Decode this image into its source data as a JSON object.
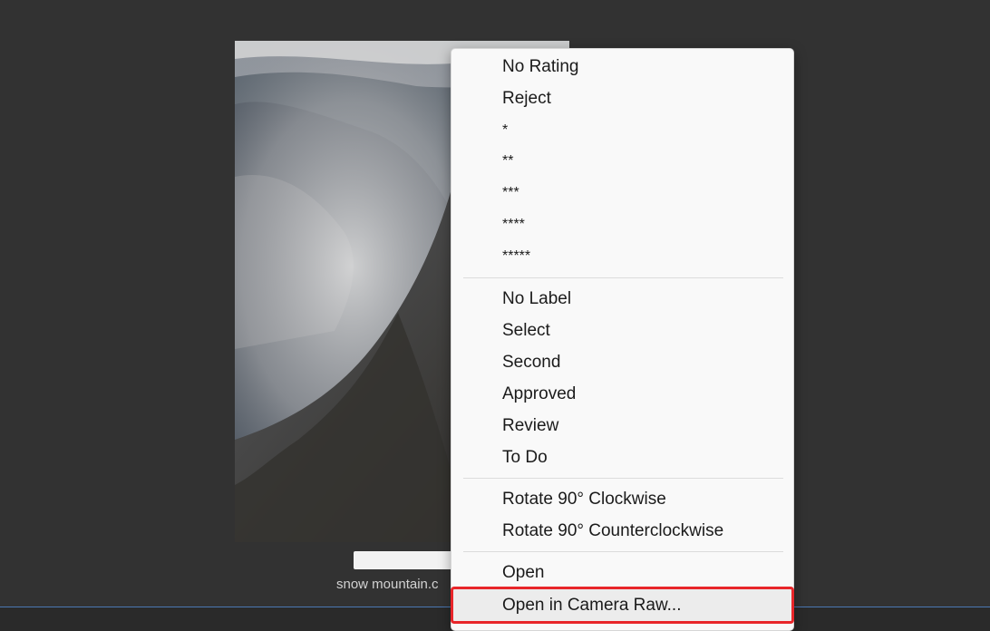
{
  "thumbnail": {
    "image": "snow-mountain-photo",
    "filename": "snow mountain.c"
  },
  "context_menu": {
    "rating_items": [
      "No Rating",
      "Reject",
      "*",
      "**",
      "***",
      "****",
      "*****"
    ],
    "label_items": [
      "No Label",
      "Select",
      "Second",
      "Approved",
      "Review",
      "To Do"
    ],
    "rotate_items": [
      "Rotate 90° Clockwise",
      "Rotate 90° Counterclockwise"
    ],
    "open_items": [
      "Open",
      "Open in Camera Raw..."
    ],
    "highlighted_item": "Open in Camera Raw...",
    "highlight_color": "#e8262a"
  },
  "colors": {
    "background": "#323232",
    "menu_background": "#f9f9f9",
    "accent_line": "#4b78b3"
  }
}
